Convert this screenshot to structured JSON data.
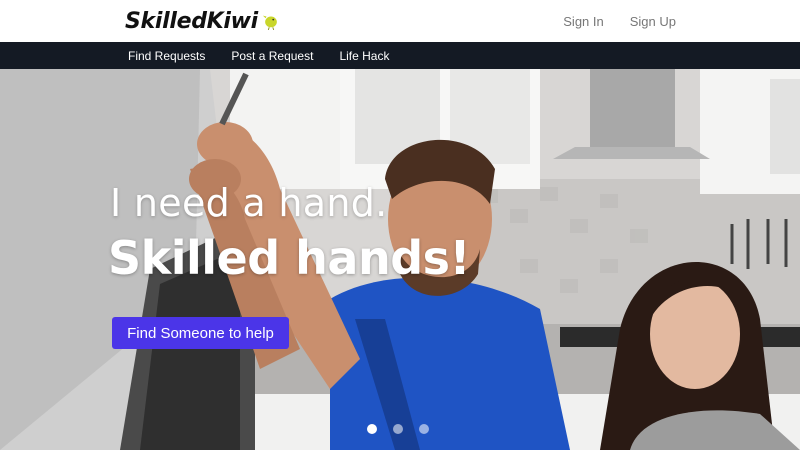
{
  "brand": {
    "name": "SkilledKiwi",
    "logo_icon": "kiwi-bird-icon",
    "logo_color": "#c9d62a"
  },
  "auth": {
    "sign_in": "Sign In",
    "sign_up": "Sign Up"
  },
  "nav": {
    "items": [
      "Find Requests",
      "Post a Request",
      "Life Hack"
    ]
  },
  "hero": {
    "line1": "I need a hand.",
    "line2": "Skilled hands!",
    "cta_label": "Find Someone to help",
    "cta_color": "#4b35e8",
    "carousel_active_index": 0
  },
  "colors": {
    "navbar": "#141a24",
    "header": "#ffffff"
  }
}
